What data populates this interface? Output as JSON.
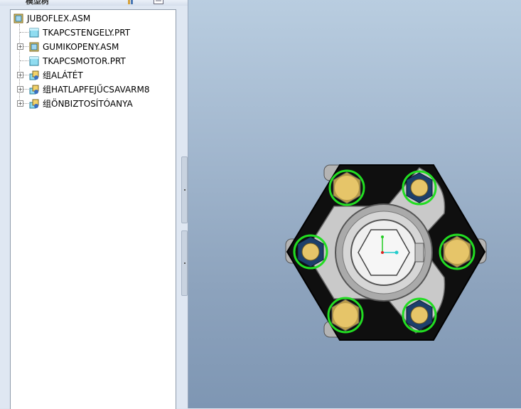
{
  "panel": {
    "title": "模型树"
  },
  "tree": {
    "items": [
      {
        "label": "JUBOFLEX.ASM",
        "type": "assembly",
        "expandable": false
      },
      {
        "label": "TKAPCSTENGELY.PRT",
        "type": "part",
        "expandable": false
      },
      {
        "label": "GUMIKOPENY.ASM",
        "type": "assembly",
        "expandable": true
      },
      {
        "label": "TKAPCSMOTOR.PRT",
        "type": "part",
        "expandable": false
      },
      {
        "label": "组ALÁTÉT",
        "type": "group",
        "expandable": true
      },
      {
        "label": "组HATLAPFEJŰCSAVARM8",
        "type": "group",
        "expandable": true
      },
      {
        "label": "组ÖNBIZTOSÍTÓANYA",
        "type": "group",
        "expandable": true
      }
    ]
  },
  "icons": {
    "assembly": "assembly-icon",
    "part": "part-icon",
    "group": "group-icon",
    "settings": "tree-settings-icon",
    "filter": "tree-filter-icon"
  },
  "colors": {
    "bolt_head": "#e6c569",
    "nut": "#1d3f6b",
    "highlight": "#22dd22",
    "coupling_body": "#101010",
    "flange": "#c8c8c8"
  }
}
